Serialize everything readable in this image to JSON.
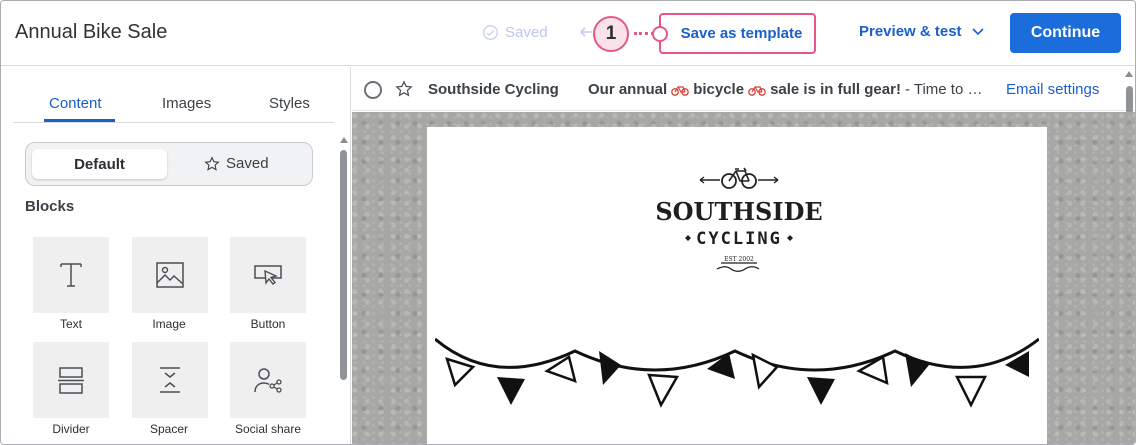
{
  "header": {
    "title": "Annual Bike Sale",
    "saved_label": "Saved",
    "callout_number": "1",
    "save_template_label": "Save as template",
    "preview_label": "Preview & test",
    "continue_label": "Continue"
  },
  "sidebar": {
    "tabs": [
      {
        "label": "Content",
        "active": true
      },
      {
        "label": "Images",
        "active": false
      },
      {
        "label": "Styles",
        "active": false
      }
    ],
    "toggle": {
      "default_label": "Default",
      "saved_label": "Saved",
      "selected": "Default"
    },
    "blocks_title": "Blocks",
    "blocks": [
      {
        "label": "Text",
        "icon": "text-icon"
      },
      {
        "label": "Image",
        "icon": "image-icon"
      },
      {
        "label": "Button",
        "icon": "button-icon"
      },
      {
        "label": "Divider",
        "icon": "divider-icon"
      },
      {
        "label": "Spacer",
        "icon": "spacer-icon"
      },
      {
        "label": "Social share",
        "icon": "social-share-icon"
      }
    ]
  },
  "email": {
    "sender": "Southside Cycling",
    "subject_bold_1": "Our annual",
    "subject_bold_2": "bicycle",
    "subject_bold_3": "sale is in full gear!",
    "subject_rest": " - Time to …",
    "settings_link": "Email settings",
    "logo": {
      "line1": "SOUTHSIDE",
      "line2": "CYCLING",
      "est": "EST 2002"
    }
  },
  "colors": {
    "accent": "#1a5fcc",
    "primary_button": "#1a6ddb",
    "callout": "#e5578a",
    "callout_fill": "#fbe1ea"
  }
}
